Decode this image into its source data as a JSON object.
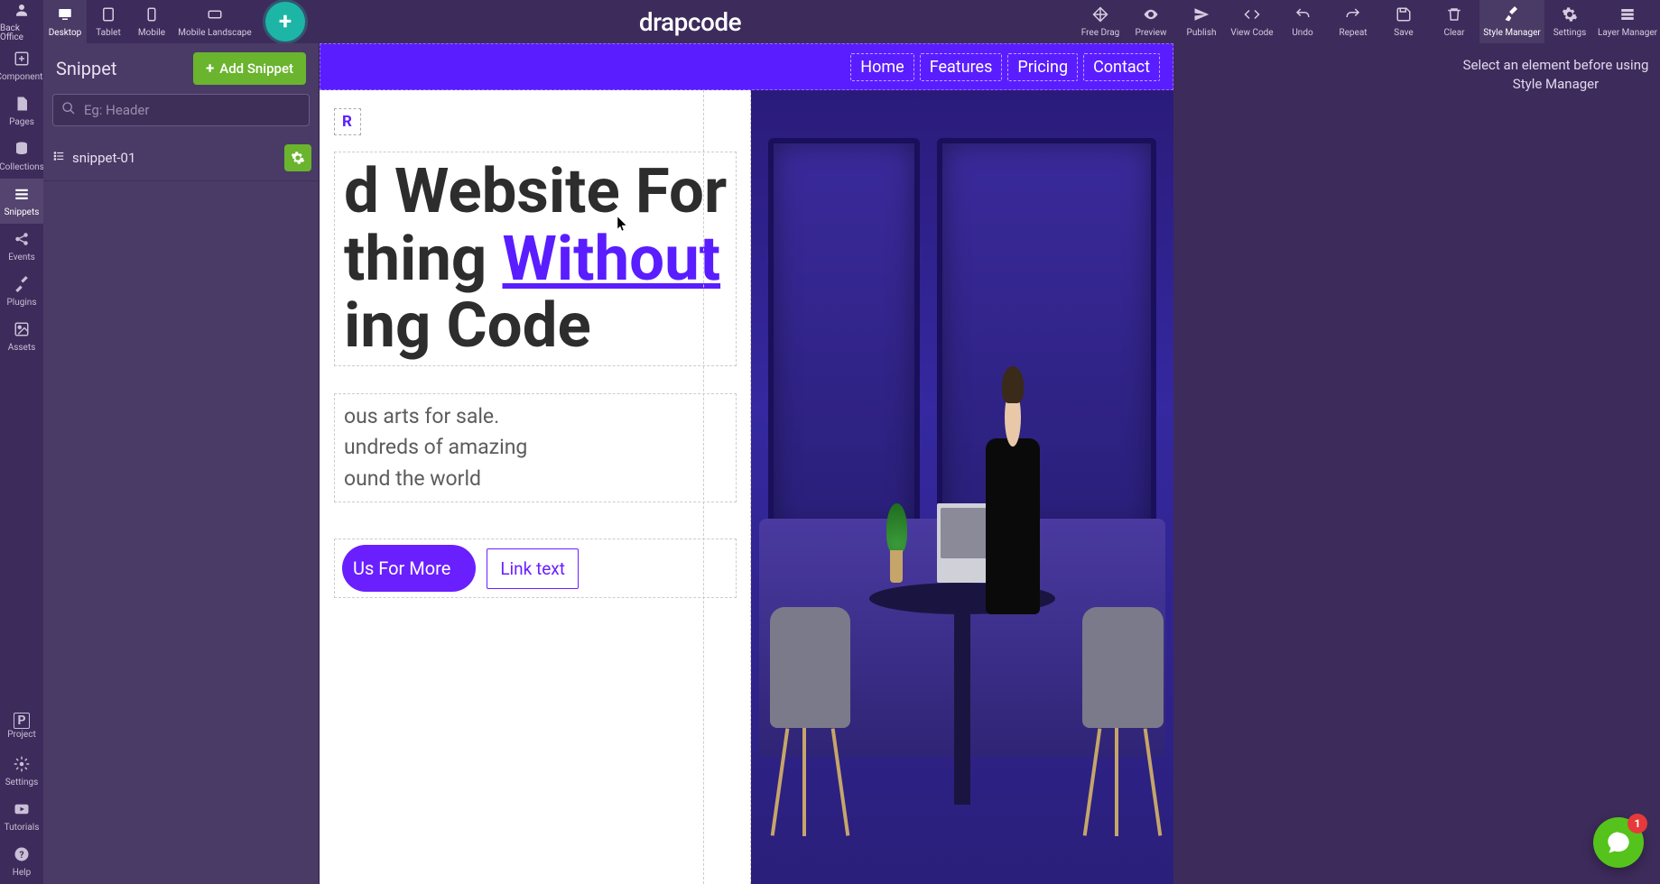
{
  "brand": "drapcode",
  "topbar": {
    "devices": [
      {
        "label": "Back Office",
        "icon": "user"
      },
      {
        "label": "Desktop",
        "icon": "desktop"
      },
      {
        "label": "Tablet",
        "icon": "tablet"
      },
      {
        "label": "Mobile",
        "icon": "mobile"
      },
      {
        "label": "Mobile Landscape",
        "icon": "mobile-land"
      }
    ],
    "actions": [
      {
        "label": "Free Drag",
        "icon": "move"
      },
      {
        "label": "Preview",
        "icon": "eye"
      },
      {
        "label": "Publish",
        "icon": "send"
      },
      {
        "label": "View Code",
        "icon": "code"
      },
      {
        "label": "Undo",
        "icon": "undo"
      },
      {
        "label": "Repeat",
        "icon": "redo"
      },
      {
        "label": "Save",
        "icon": "save"
      },
      {
        "label": "Clear",
        "icon": "trash"
      },
      {
        "label": "Style Manager",
        "icon": "brush"
      },
      {
        "label": "Settings",
        "icon": "gear"
      },
      {
        "label": "Layer Manager",
        "icon": "layers"
      }
    ],
    "active_device": "Desktop",
    "active_action": "Style Manager"
  },
  "leftrail": {
    "top": [
      {
        "label": "Components",
        "icon": "plus-square"
      },
      {
        "label": "Pages",
        "icon": "file"
      },
      {
        "label": "Collections",
        "icon": "database"
      },
      {
        "label": "Snippets",
        "icon": "bars"
      },
      {
        "label": "Events",
        "icon": "share"
      },
      {
        "label": "Plugins",
        "icon": "tools"
      },
      {
        "label": "Assets",
        "icon": "image"
      }
    ],
    "bottom": [
      {
        "label": "Project",
        "icon": "p"
      },
      {
        "label": "Settings",
        "icon": "sliders"
      },
      {
        "label": "Tutorials",
        "icon": "youtube"
      },
      {
        "label": "Help",
        "icon": "question"
      }
    ],
    "active": "Snippets"
  },
  "snippet_panel": {
    "title": "Snippet",
    "add_label": "Add Snippet",
    "search_placeholder": "Eg: Header",
    "items": [
      {
        "name": "snippet-01"
      }
    ]
  },
  "canvas": {
    "nav": [
      "Home",
      "Features",
      "Pricing",
      "Contact"
    ],
    "tag": "R",
    "headline_lines": [
      {
        "prefix": "d Website For",
        "accent": ""
      },
      {
        "prefix": "thing ",
        "accent": "Without"
      },
      {
        "prefix": "ing Code",
        "accent": ""
      }
    ],
    "subtext_lines": [
      "ous arts for sale.",
      "undreds of amazing",
      "ound the world"
    ],
    "cta_primary": "Us For More",
    "cta_link": "Link text"
  },
  "right_panel": {
    "message": "Select an element before using Style Manager"
  },
  "chat": {
    "badge": "1"
  },
  "colors": {
    "bg": "#3d2b5b",
    "panel": "#4a3a66",
    "accent_green": "#6ab42e",
    "accent_teal": "#1db5a6",
    "canvas_nav": "#5a1dff",
    "accent_purple": "#6a1fff",
    "chat_green": "#55c31b",
    "badge_red": "#e63a3a"
  }
}
